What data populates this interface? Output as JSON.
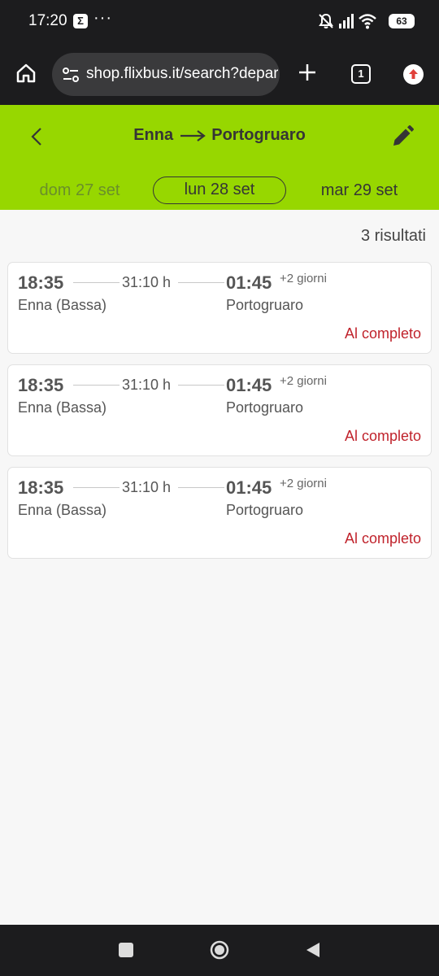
{
  "status_bar": {
    "time": "17:20",
    "notification_icon": "sigma-icon",
    "more": "···",
    "battery": "63"
  },
  "browser": {
    "url": "shop.flixbus.it/search?departureCity",
    "tab_count": "1"
  },
  "header": {
    "from": "Enna",
    "to": "Portogruaro",
    "accent_color": "#97d700",
    "days": {
      "prev": "dom 27 set",
      "current": "lun 28 set",
      "next": "mar 29 set"
    }
  },
  "results": {
    "count_label": "3 risultati",
    "trips": [
      {
        "departure_time": "18:35",
        "duration": "31:10 h",
        "arrival_time": "01:45",
        "day_offset": "+2 giorni",
        "departure_station": "Enna (Bassa)",
        "arrival_station": "Portogruaro",
        "status": "Al completo"
      },
      {
        "departure_time": "18:35",
        "duration": "31:10 h",
        "arrival_time": "01:45",
        "day_offset": "+2 giorni",
        "departure_station": "Enna (Bassa)",
        "arrival_station": "Portogruaro",
        "status": "Al completo"
      },
      {
        "departure_time": "18:35",
        "duration": "31:10 h",
        "arrival_time": "01:45",
        "day_offset": "+2 giorni",
        "departure_station": "Enna (Bassa)",
        "arrival_station": "Portogruaro",
        "status": "Al completo"
      }
    ]
  },
  "colors": {
    "status_full": "#c0232c"
  }
}
